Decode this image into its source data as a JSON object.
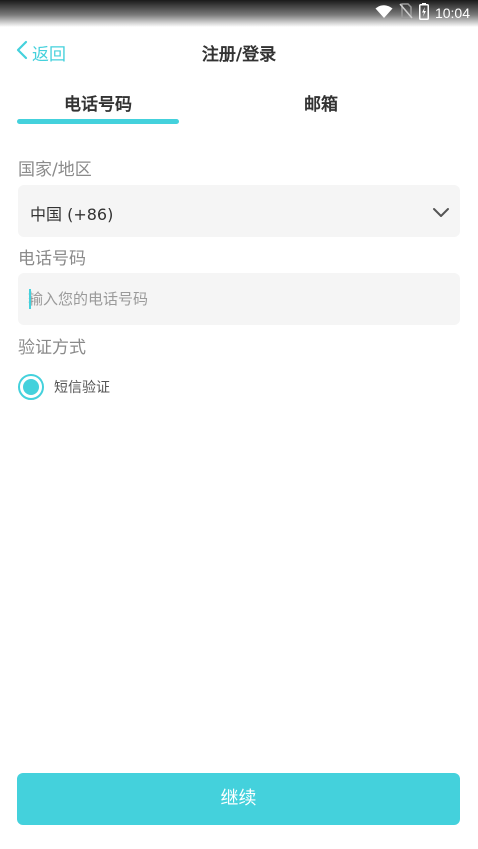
{
  "status_bar": {
    "time": "10:04",
    "icons": [
      "wifi-icon",
      "no-sim-icon",
      "battery-charging-icon"
    ]
  },
  "header": {
    "back_label": "返回",
    "title": "注册/登录"
  },
  "tabs": [
    {
      "label": "电话号码",
      "active": true
    },
    {
      "label": "邮箱",
      "active": false
    }
  ],
  "form": {
    "country_label": "国家/地区",
    "country_value": "中国 (+86)",
    "phone_label": "电话号码",
    "phone_placeholder": "输入您的电话号码",
    "phone_value": "",
    "verify_label": "验证方式",
    "verify_option": "短信验证"
  },
  "continue_label": "继续",
  "colors": {
    "accent": "#44d1dc",
    "field_background": "#f5f5f5",
    "label_gray": "#8a8a8a",
    "text_dark": "#333333"
  }
}
